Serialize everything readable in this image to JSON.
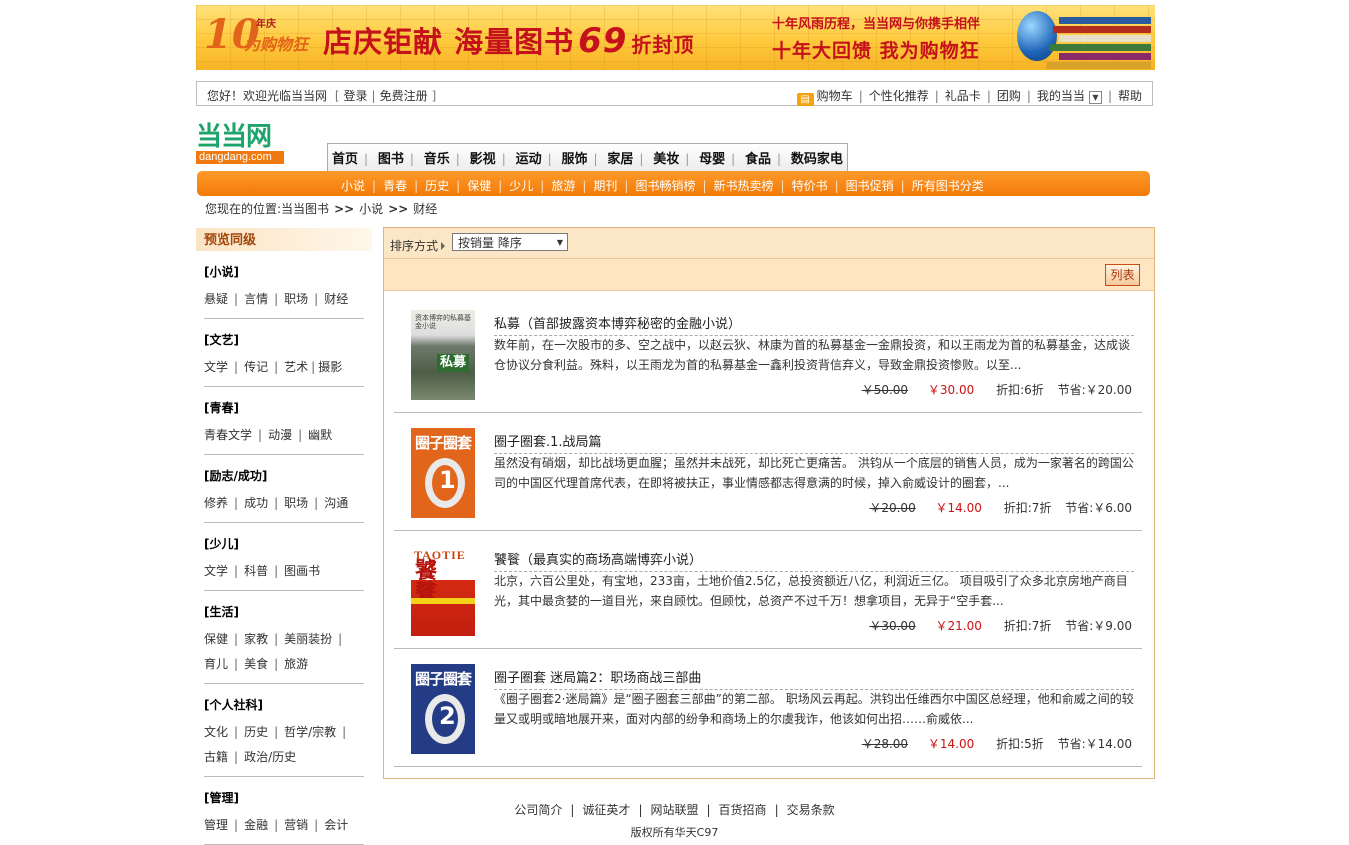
{
  "banner": {
    "anniv_num": "10",
    "anniv_sup": "年庆",
    "anniv_text": "为购物狂",
    "headline_a": "店庆钜献  海量图书",
    "headline_num": "69",
    "headline_b": "折封顶",
    "right_line1": "十年风雨历程，当当网与你携手相伴",
    "right_line2": "十年大回馈  我为购物狂"
  },
  "topbar": {
    "welcome": "您好！欢迎光临当当网",
    "login": "登录",
    "register": "免费注册",
    "cart": "购物车",
    "recommend": "个性化推荐",
    "giftcard": "礼品卡",
    "group": "团购",
    "my_dangdang": "我的当当",
    "help": "帮助"
  },
  "logo": {
    "cn": "当当网",
    "en": "dangdang.com"
  },
  "main_tabs": [
    "首页",
    "图书",
    "音乐",
    "影视",
    "运动",
    "服饰",
    "家居",
    "美妆",
    "母婴",
    "食品",
    "数码家电"
  ],
  "sub_nav": [
    "小说",
    "青春",
    "历史",
    "保健",
    "少儿",
    "旅游",
    "期刊",
    "图书畅销榜",
    "新书热卖榜",
    "特价书",
    "图书促销",
    "所有图书分类"
  ],
  "breadcrumb": {
    "prefix": "您现在的位置:",
    "l1": "当当图书",
    "l2": "小说",
    "l3": "财经",
    "arrow": ">>"
  },
  "sidebar": {
    "title": "预览同级",
    "cats": [
      {
        "head": "[小说]",
        "rows": [
          [
            "悬疑",
            "言情",
            "职场",
            "财经"
          ]
        ]
      },
      {
        "head": "[文艺]",
        "rows": [
          [
            "文学",
            "传记",
            "艺术",
            "摄影"
          ]
        ]
      },
      {
        "head": "[青春]",
        "rows": [
          [
            "青春文学",
            "动漫",
            "幽默"
          ]
        ]
      },
      {
        "head": "[励志/成功]",
        "rows": [
          [
            "修养",
            "成功",
            "职场",
            "沟通"
          ]
        ]
      },
      {
        "head": "[少儿]",
        "rows": [
          [
            "文学",
            "科普",
            "图画书"
          ]
        ]
      },
      {
        "head": "[生活]",
        "rows": [
          [
            "保健",
            "家教",
            "美丽装扮"
          ],
          [
            "育儿",
            "美食",
            "旅游"
          ]
        ]
      },
      {
        "head": "[个人社科]",
        "rows": [
          [
            "文化",
            "历史",
            "哲学/宗教"
          ],
          [
            "古籍",
            "政治/历史"
          ]
        ]
      },
      {
        "head": "[管理]",
        "rows": [
          [
            "管理",
            "金融",
            "营销",
            "会计"
          ]
        ]
      }
    ]
  },
  "sort": {
    "label": "排序方式",
    "selected": "按销量 降序",
    "list_btn": "列表"
  },
  "books": [
    {
      "title": "私募（首部披露资本博弈秘密的金融小说）",
      "desc": "数年前，在一次股市的多、空之战中，以赵云狄、林康为首的私募基金一金鼎投资，和以王雨龙为首的私募基金，达成谈仓协议分食利益。殊料，以王雨龙为首的私募基金一鑫利投资背信弃义，导致金鼎投资惨败。以至...",
      "orig": "￥50.00",
      "now": "￥30.00",
      "disc": "折扣:6折",
      "save": "节省:￥20.00",
      "cover": {
        "top": "资本博弈的私募基金小说",
        "main": "私募"
      }
    },
    {
      "title": "圈子圈套.1.战局篇",
      "desc": "虽然没有硝烟，却比战场更血腥；虽然并未战死，却比死亡更痛苦。 洪钧从一个底层的销售人员，成为一家著名的跨国公司的中国区代理首席代表，在即将被扶正，事业情感都志得意满的时候，掉入俞威设计的圈套，...",
      "orig": "￥20.00",
      "now": "￥14.00",
      "disc": "折扣:7折",
      "save": "节省:￥6.00",
      "cover": {
        "title": "圈子圈套",
        "num": "1"
      }
    },
    {
      "title": "饕餮（最真实的商场高端博弈小说）",
      "desc": "北京，六百公里处，有宝地，233亩，土地价值2.5亿，总投资额近八亿，利润近三亿。  项目吸引了众多北京房地产商目光，其中最贪婪的一道目光，来自顾忱。但顾忱，总资产不过千万！想拿项目，无异于“空手套...",
      "orig": "￥30.00",
      "now": "￥21.00",
      "disc": "折扣:7折",
      "save": "节省:￥9.00",
      "cover": {
        "en": "TAOTIE",
        "cn": "饕餮"
      }
    },
    {
      "title": "圈子圈套 迷局篇2：职场商战三部曲",
      "desc": "《圈子圈套2·迷局篇》是“圈子圈套三部曲”的第二部。 职场风云再起。洪钧出任维西尔中国区总经理，他和俞威之间的较量又或明或暗地展开来，面对内部的纷争和商场上的尔虞我诈，他该如何出招……俞威依...",
      "orig": "￥28.00",
      "now": "￥14.00",
      "disc": "折扣:5折",
      "save": "节省:￥14.00",
      "cover": {
        "title": "圈子圈套",
        "num": "2"
      }
    }
  ],
  "footer": {
    "links": [
      "公司简介",
      "诚征英才",
      "网站联盟",
      "百货招商",
      "交易条款"
    ],
    "copy": "版权所有华天C97"
  },
  "colors": {
    "accent": "#f27a08",
    "price": "#cc1111",
    "panel_border": "#e0b37c"
  }
}
